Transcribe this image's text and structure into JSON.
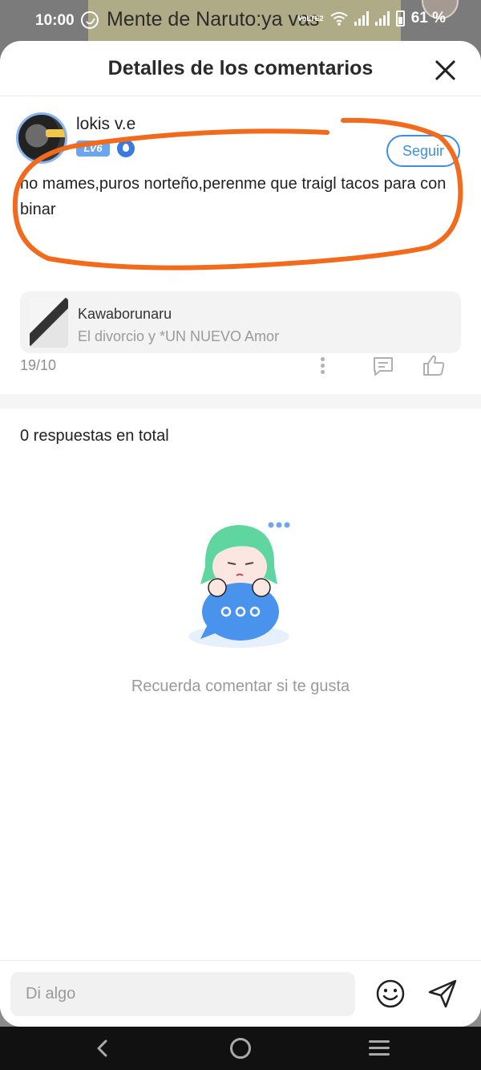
{
  "status_bar": {
    "time": "10:00",
    "network_label": "VoLTE2",
    "battery_percent": "61 %",
    "icons": [
      "whatsapp-icon",
      "wifi-icon",
      "signal-icon",
      "signal-icon",
      "battery-icon"
    ]
  },
  "background_app": {
    "title_text": "Mente de Naruto:ya vas"
  },
  "sheet": {
    "title": "Detalles de los comentarios",
    "close_icon": "close-icon"
  },
  "comment": {
    "username": "lokis v.e",
    "level_badge": "LV6",
    "follow_label": "Seguir",
    "text": "no mames,puros norteño,perenme que traigl tacos para con binar",
    "reference": {
      "author": "Kawaborunaru",
      "title": "El divorcio y *UN NUEVO Amor"
    },
    "date": "19/10",
    "actions": [
      "more-icon",
      "reply-icon",
      "like-icon"
    ]
  },
  "replies": {
    "count_label": "0 respuestas en total",
    "empty_message": "Recuerda comentar si te gusta"
  },
  "input": {
    "placeholder": "Di algo",
    "emoji_icon": "emoji-icon",
    "send_icon": "send-icon"
  },
  "colors": {
    "accent_blue": "#3e8de8",
    "annotation_orange": "#f26a1b",
    "mascot_green": "#5fd6a0",
    "bubble_blue": "#4a93ec"
  }
}
